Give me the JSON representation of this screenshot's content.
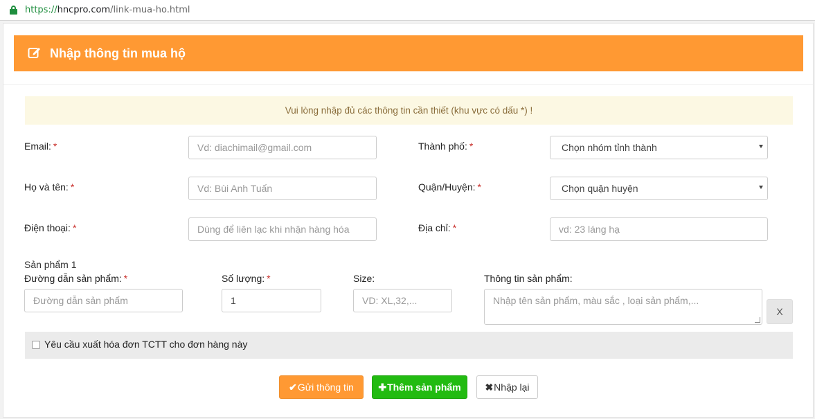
{
  "browser": {
    "url_protocol": "https://",
    "url_host": "hncpro.com",
    "url_path": "/link-mua-ho.html"
  },
  "panel": {
    "title": "Nhập thông tin mua hộ",
    "header_color": "#ff9933"
  },
  "alert": "Vui lòng nhập đủ các thông tin cần thiết (khu vực có dấu *) !",
  "form": {
    "email": {
      "label": "Email:",
      "required_mark": "*",
      "placeholder": "Vd: diachimail@gmail.com"
    },
    "name": {
      "label": "Họ và tên:",
      "required_mark": "*",
      "placeholder": "Vd: Bùi Anh Tuấn"
    },
    "phone": {
      "label": "Điện thoại:",
      "required_mark": "*",
      "placeholder": "Dùng để liên lạc khi nhận hàng hóa"
    },
    "city": {
      "label": "Thành phố:",
      "required_mark": "*",
      "selected": "Chọn nhóm tỉnh thành"
    },
    "district": {
      "label": "Quận/Huyện:",
      "required_mark": "*",
      "selected": "Chọn quận huyện"
    },
    "address": {
      "label": "Địa chỉ:",
      "required_mark": "*",
      "placeholder": "vd: 23 láng hạ"
    }
  },
  "product": {
    "heading": "Sản phẩm 1",
    "link": {
      "label": "Đường dẫn sản phẩm:",
      "required_mark": "*",
      "placeholder": "Đường dẫn sản phẩm"
    },
    "quantity": {
      "label": "Số lượng:",
      "required_mark": "*",
      "value": "1"
    },
    "size": {
      "label": "Size:",
      "placeholder": "VD: XL,32,..."
    },
    "info": {
      "label": "Thông tin sản phẩm:",
      "placeholder": "Nhập tên sản phẩm, màu sắc , loại sản phẩm,..."
    },
    "remove_label": "X"
  },
  "invoice": {
    "label": "Yêu cầu xuất hóa đơn TCTT cho đơn hàng này",
    "checked": false
  },
  "buttons": {
    "send_icon": "✔",
    "send": "Gửi thông tin",
    "add_icon": "✚",
    "add": "Thêm sản phẩm",
    "reset_icon": "✖",
    "reset": "Nhập lại"
  },
  "icons": {
    "lock": "lock-icon",
    "edit": "edit-icon",
    "check": "check-icon",
    "plus": "plus-icon",
    "remove": "remove-icon"
  },
  "colors": {
    "accent_orange": "#ff9933",
    "add_green": "#22bb11",
    "required_red": "#c9302c",
    "alert_bg": "#fcf8e3",
    "alert_text": "#8a6d3b"
  }
}
